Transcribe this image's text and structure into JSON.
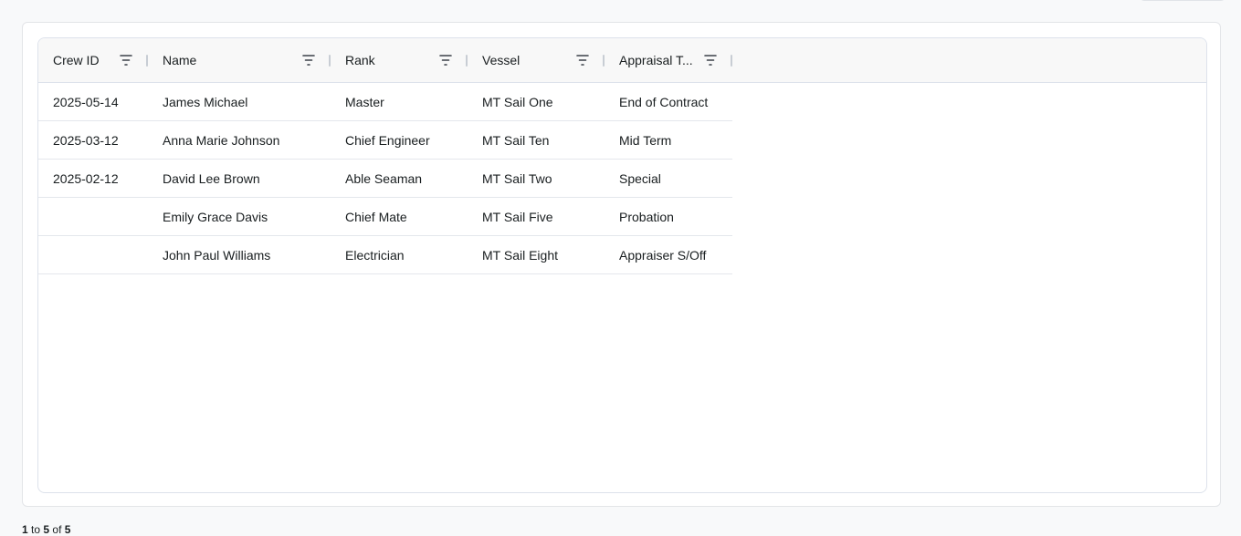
{
  "grid": {
    "columns": [
      {
        "label": "Crew ID"
      },
      {
        "label": "Name"
      },
      {
        "label": "Rank"
      },
      {
        "label": "Vessel"
      },
      {
        "label": "Appraisal T..."
      }
    ],
    "rows": [
      {
        "crew_id": "2025-05-14",
        "name": "James Michael",
        "rank": "Master",
        "vessel": "MT Sail One",
        "appraisal": "End of Contract"
      },
      {
        "crew_id": "2025-03-12",
        "name": "Anna Marie Johnson",
        "rank": "Chief Engineer",
        "vessel": "MT Sail Ten",
        "appraisal": "Mid Term"
      },
      {
        "crew_id": "2025-02-12",
        "name": "David Lee Brown",
        "rank": "Able Seaman",
        "vessel": "MT Sail Two",
        "appraisal": "Special"
      },
      {
        "crew_id": "",
        "name": "Emily Grace Davis",
        "rank": "Chief Mate",
        "vessel": "MT Sail Five",
        "appraisal": "Probation"
      },
      {
        "crew_id": "",
        "name": "John Paul Williams",
        "rank": "Electrician",
        "vessel": "MT Sail Eight",
        "appraisal": "Appraiser S/Off"
      }
    ]
  },
  "pagination": {
    "from": "1",
    "to_word": "to",
    "to": "5",
    "of_word": "of",
    "total": "5"
  },
  "icons": {
    "filter": "filter-icon"
  }
}
